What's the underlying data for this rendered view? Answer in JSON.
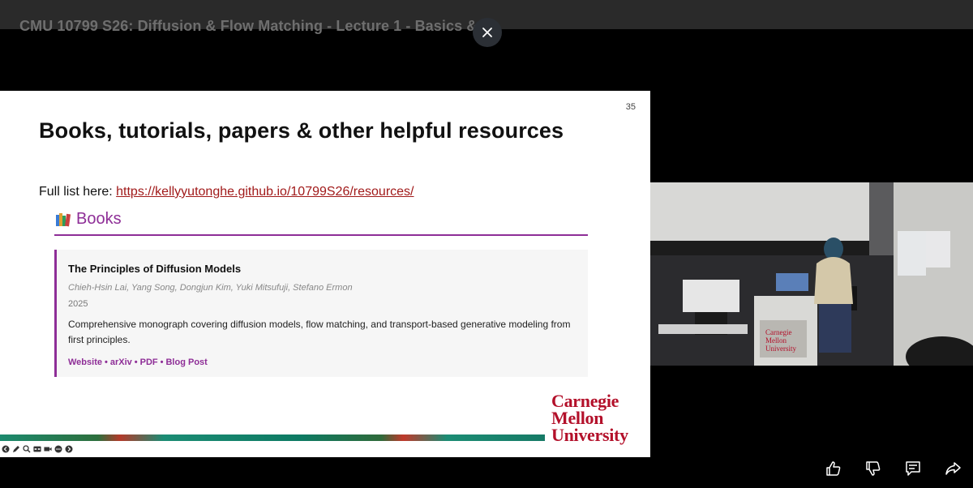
{
  "video": {
    "title": "CMU 10799 S26: Diffusion & Flow Matching - Lecture 1 - Basics & ..."
  },
  "slide": {
    "number": "35",
    "title": "Books, tutorials, papers & other helpful resources",
    "full_list_label": "Full list here: ",
    "full_list_url": "https://kellyyutonghe.github.io/10799S26/resources/",
    "books_heading": "Books",
    "book": {
      "title": "The Principles of Diffusion Models",
      "authors": "Chieh-Hsin Lai, Yang Song, Dongjun Kim, Yuki Mitsufuji, Stefano Ermon",
      "year": "2025",
      "description": "Comprehensive monograph covering diffusion models, flow matching, and transport-based generative modeling from first principles.",
      "links": [
        "Website",
        "arXiv",
        "PDF",
        "Blog Post"
      ],
      "link_separator": "•"
    },
    "logo_lines": [
      "Carnegie",
      "Mellon",
      "University"
    ]
  },
  "slide_controls": [
    "prev-icon",
    "pen-icon",
    "zoom-icon",
    "captions-icon",
    "camera-icon",
    "more-icon",
    "next-icon"
  ],
  "actions": [
    "thumbs-up-icon",
    "thumbs-down-icon",
    "comment-icon",
    "share-icon"
  ],
  "colors": {
    "accent_purple": "#8e2e97",
    "link_red": "#a11a1a",
    "cmu_red": "#b3102a",
    "background": "#000000",
    "topbar": "#2a2a2a"
  }
}
